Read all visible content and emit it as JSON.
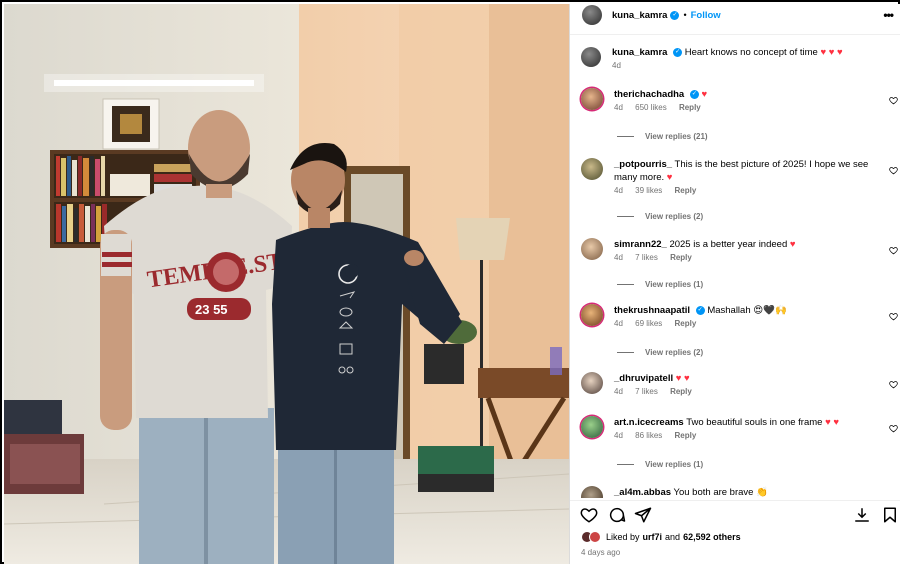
{
  "post": {
    "username": "kuna_kamra",
    "follow_label": "Follow",
    "dot": "•",
    "more_label": "•••",
    "caption": "Heart knows no concept of time",
    "caption_time": "4d"
  },
  "comments": [
    {
      "user": "therichachadha",
      "verified": true,
      "text": "",
      "emoji": "♥",
      "time": "4d",
      "likes": "650 likes",
      "reply": "Reply",
      "view_replies": "View replies (21)"
    },
    {
      "user": "_potpourris_",
      "verified": false,
      "text": "This is the best picture of 2025! I hope we see many more.",
      "emoji": "♥",
      "time": "4d",
      "likes": "39 likes",
      "reply": "Reply",
      "view_replies": "View replies (2)"
    },
    {
      "user": "simrann22_",
      "verified": false,
      "text": "2025 is a better year indeed",
      "emoji": "♥",
      "time": "4d",
      "likes": "7 likes",
      "reply": "Reply",
      "view_replies": "View replies (1)"
    },
    {
      "user": "thekrushnaapatil",
      "verified": true,
      "text": "Mashallah",
      "emoji": "😍🖤🙌",
      "time": "4d",
      "likes": "69 likes",
      "reply": "Reply",
      "view_replies": "View replies (2)"
    },
    {
      "user": "_dhruvipatell",
      "verified": false,
      "text": "",
      "emoji": "♥ ♥",
      "time": "4d",
      "likes": "7 likes",
      "reply": "Reply",
      "view_replies": ""
    },
    {
      "user": "art.n.icecreams",
      "verified": false,
      "text": "Two beautiful souls in one frame",
      "emoji": "♥ ♥",
      "time": "4d",
      "likes": "86 likes",
      "reply": "Reply",
      "view_replies": "View replies (1)"
    },
    {
      "user": "_al4m.abbas",
      "verified": false,
      "text": "You both are brave",
      "emoji": "👏",
      "time": "",
      "likes": "",
      "reply": "",
      "view_replies": ""
    }
  ],
  "footer": {
    "liked_by_prefix": "Liked by",
    "liked_by_user": "urf7i",
    "liked_by_and": "and",
    "liked_by_others": "62,592 others",
    "time_ago": "4 days ago"
  },
  "photo": {
    "shirt_text": "TEMPLE.ST",
    "shirt_number": "23  55"
  },
  "colors": {
    "accent_blue": "#0095f6",
    "heart_red": "#ff3040",
    "muted_text": "#737373"
  },
  "icons": [
    "heart-icon",
    "comment-icon",
    "share-icon",
    "save-icon",
    "more-icon",
    "verified-icon"
  ]
}
